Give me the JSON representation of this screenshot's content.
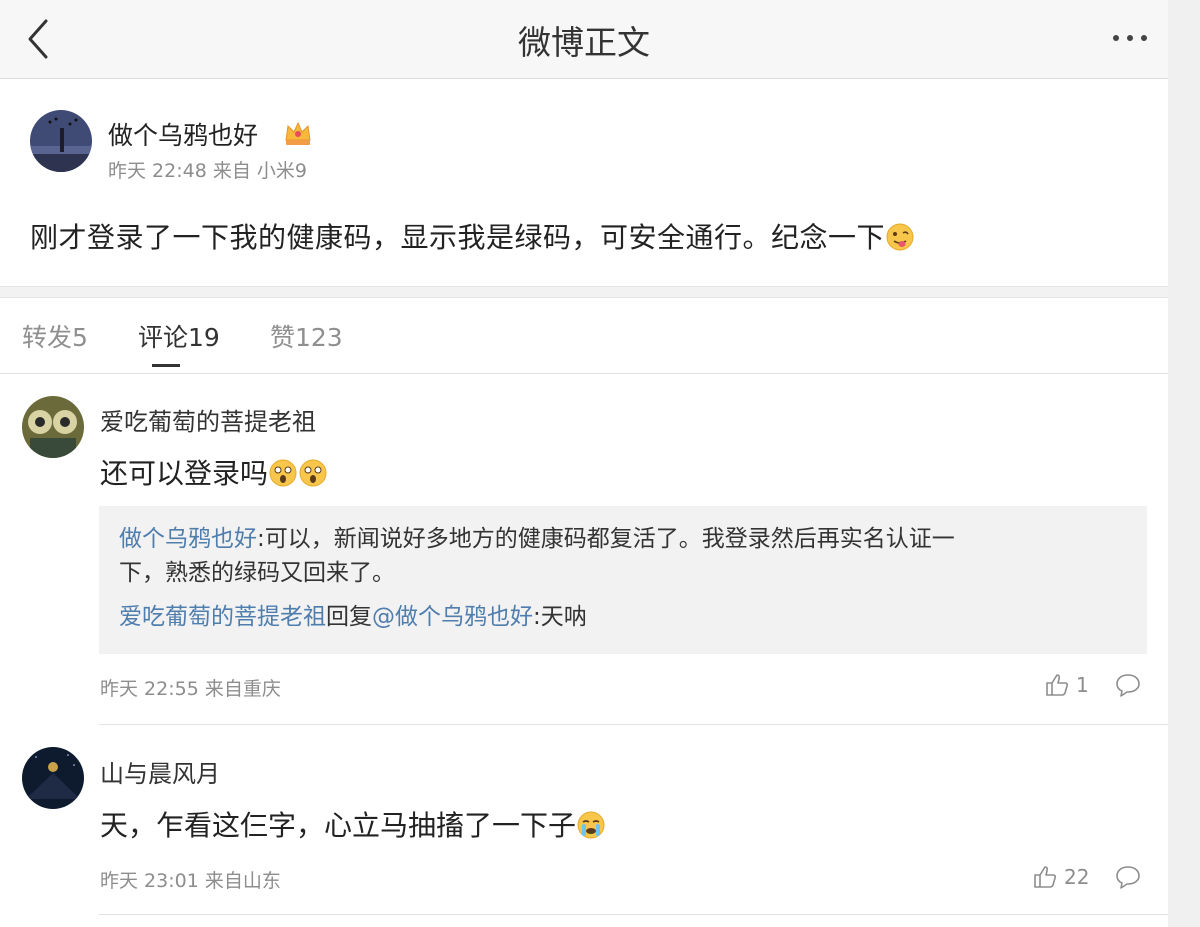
{
  "header": {
    "title": "微博正文"
  },
  "post": {
    "author": "做个乌鸦也好",
    "time": "昨天 22:48",
    "source": "来自 小米9",
    "text": "刚才登录了一下我的健康码，显示我是绿码，可安全通行。纪念一下"
  },
  "tabs": [
    {
      "label": "转发5"
    },
    {
      "label": "评论19"
    },
    {
      "label": "赞123"
    }
  ],
  "comments": [
    {
      "name": "爱吃葡萄的菩提老祖",
      "text": "还可以登录吗",
      "replies": {
        "r1_name": "做个乌鸦也好",
        "r1_text_line1": ":可以，新闻说好多地方的健康码都复活了。我登录然后再实名认证一",
        "r1_text_line2": "下，熟悉的绿码又回来了。",
        "r2_name": "爱吃葡萄的菩提老祖",
        "r2_mid": "回复",
        "r2_target": "@做个乌鸦也好",
        "r2_text": ":天呐"
      },
      "meta": "昨天 22:55 来自重庆",
      "likes": "1"
    },
    {
      "name": "山与晨风月",
      "text": "天，乍看这仨字，心立马抽搐了一下子",
      "meta": "昨天 23:01 来自山东",
      "likes": "22"
    }
  ],
  "colors": {
    "link": "#4f7dae",
    "meta": "#8d8d8d",
    "header_bg": "#f7f7f7"
  },
  "icons": [
    "back-icon",
    "more-icon",
    "crown-icon",
    "tongue-emoji",
    "shocked-emoji",
    "crying-emoji",
    "thumbs-up-icon",
    "comment-icon"
  ]
}
